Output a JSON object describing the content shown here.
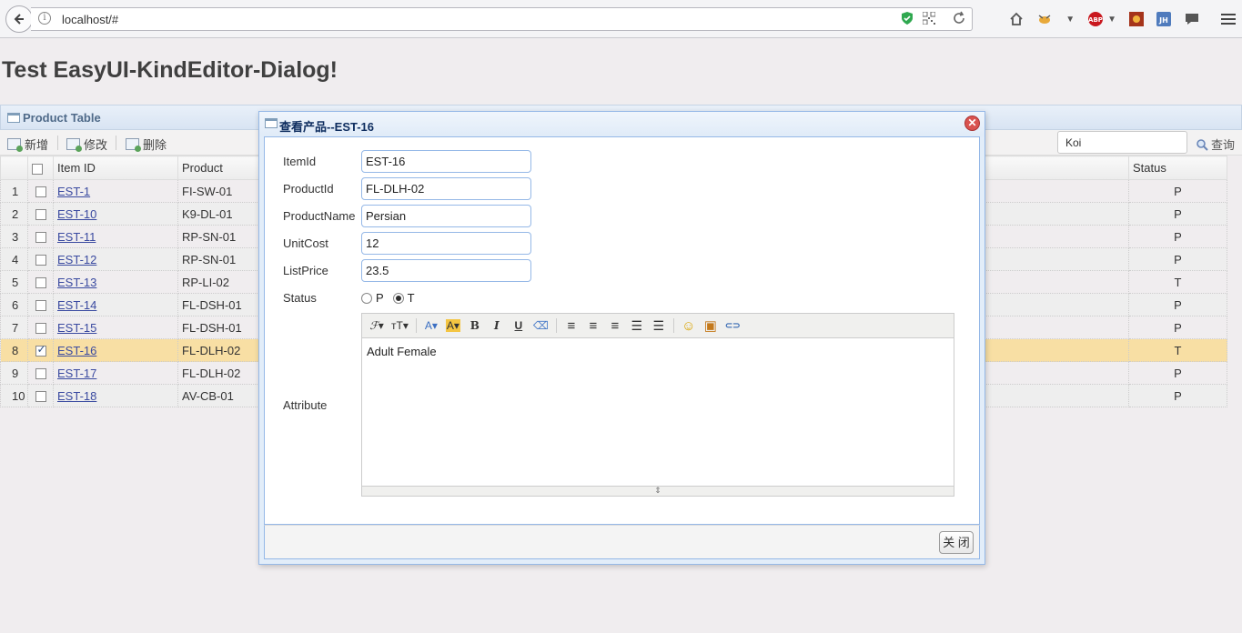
{
  "browser": {
    "url": "localhost/#",
    "info_glyph": "i"
  },
  "page": {
    "title": "Test EasyUI-KindEditor-Dialog!"
  },
  "grid_panel": {
    "title": "Product Table",
    "toolbar": {
      "add_label": "新增",
      "edit_label": "修改",
      "delete_label": "删除",
      "search_value": "Koi",
      "search_label": "查询"
    },
    "columns": {
      "item_id": "Item ID",
      "product": "Product",
      "status": "Status"
    },
    "rows": [
      {
        "num": "1",
        "item_id": "EST-1",
        "product": "FI-SW-01",
        "status": "P",
        "checked": false
      },
      {
        "num": "2",
        "item_id": "EST-10",
        "product": "K9-DL-01",
        "status": "P",
        "checked": false
      },
      {
        "num": "3",
        "item_id": "EST-11",
        "product": "RP-SN-01",
        "status": "P",
        "checked": false
      },
      {
        "num": "4",
        "item_id": "EST-12",
        "product": "RP-SN-01",
        "status": "P",
        "checked": false
      },
      {
        "num": "5",
        "item_id": "EST-13",
        "product": "RP-LI-02",
        "status": "T",
        "checked": false
      },
      {
        "num": "6",
        "item_id": "EST-14",
        "product": "FL-DSH-01",
        "status": "P",
        "checked": false
      },
      {
        "num": "7",
        "item_id": "EST-15",
        "product": "FL-DSH-01",
        "status": "P",
        "checked": false
      },
      {
        "num": "8",
        "item_id": "EST-16",
        "product": "FL-DLH-02",
        "status": "T",
        "checked": true
      },
      {
        "num": "9",
        "item_id": "EST-17",
        "product": "FL-DLH-02",
        "status": "P",
        "checked": false
      },
      {
        "num": "10",
        "item_id": "EST-18",
        "product": "AV-CB-01",
        "status": "P",
        "checked": false
      }
    ]
  },
  "dialog": {
    "title": "查看产品--EST-16",
    "close_glyph": "✕",
    "fields": {
      "item_id_label": "ItemId",
      "item_id_value": "EST-16",
      "product_id_label": "ProductId",
      "product_id_value": "FL-DLH-02",
      "product_name_label": "ProductName",
      "product_name_value": "Persian",
      "unit_cost_label": "UnitCost",
      "unit_cost_value": "12",
      "list_price_label": "ListPrice",
      "list_price_value": "23.5",
      "status_label": "Status",
      "status_option_p": "P",
      "status_option_t": "T",
      "status_selected": "T",
      "attribute_label": "Attribute"
    },
    "editor": {
      "content": "Adult Female",
      "toolbar_glyphs": {
        "font_name": "ℱ▾",
        "font_size": "тT▾",
        "fore_color": "A▾",
        "hilite_color": "A▾",
        "bold": "B",
        "italic": "I",
        "underline": "U",
        "remove_format": "⌫",
        "align_left": "≡",
        "align_center": "≡",
        "align_right": "≡",
        "ordered_list": "☰",
        "unordered_list": "☰",
        "emoticon": "☺",
        "image": "▣",
        "link": "⊂⊃"
      },
      "resize_glyph": "⇕"
    },
    "close_button_label": "关 闭"
  },
  "colors": {
    "selected_row": "#f8dfa4",
    "dialog_border": "#95b8e7",
    "link": "#3a4aa0"
  }
}
